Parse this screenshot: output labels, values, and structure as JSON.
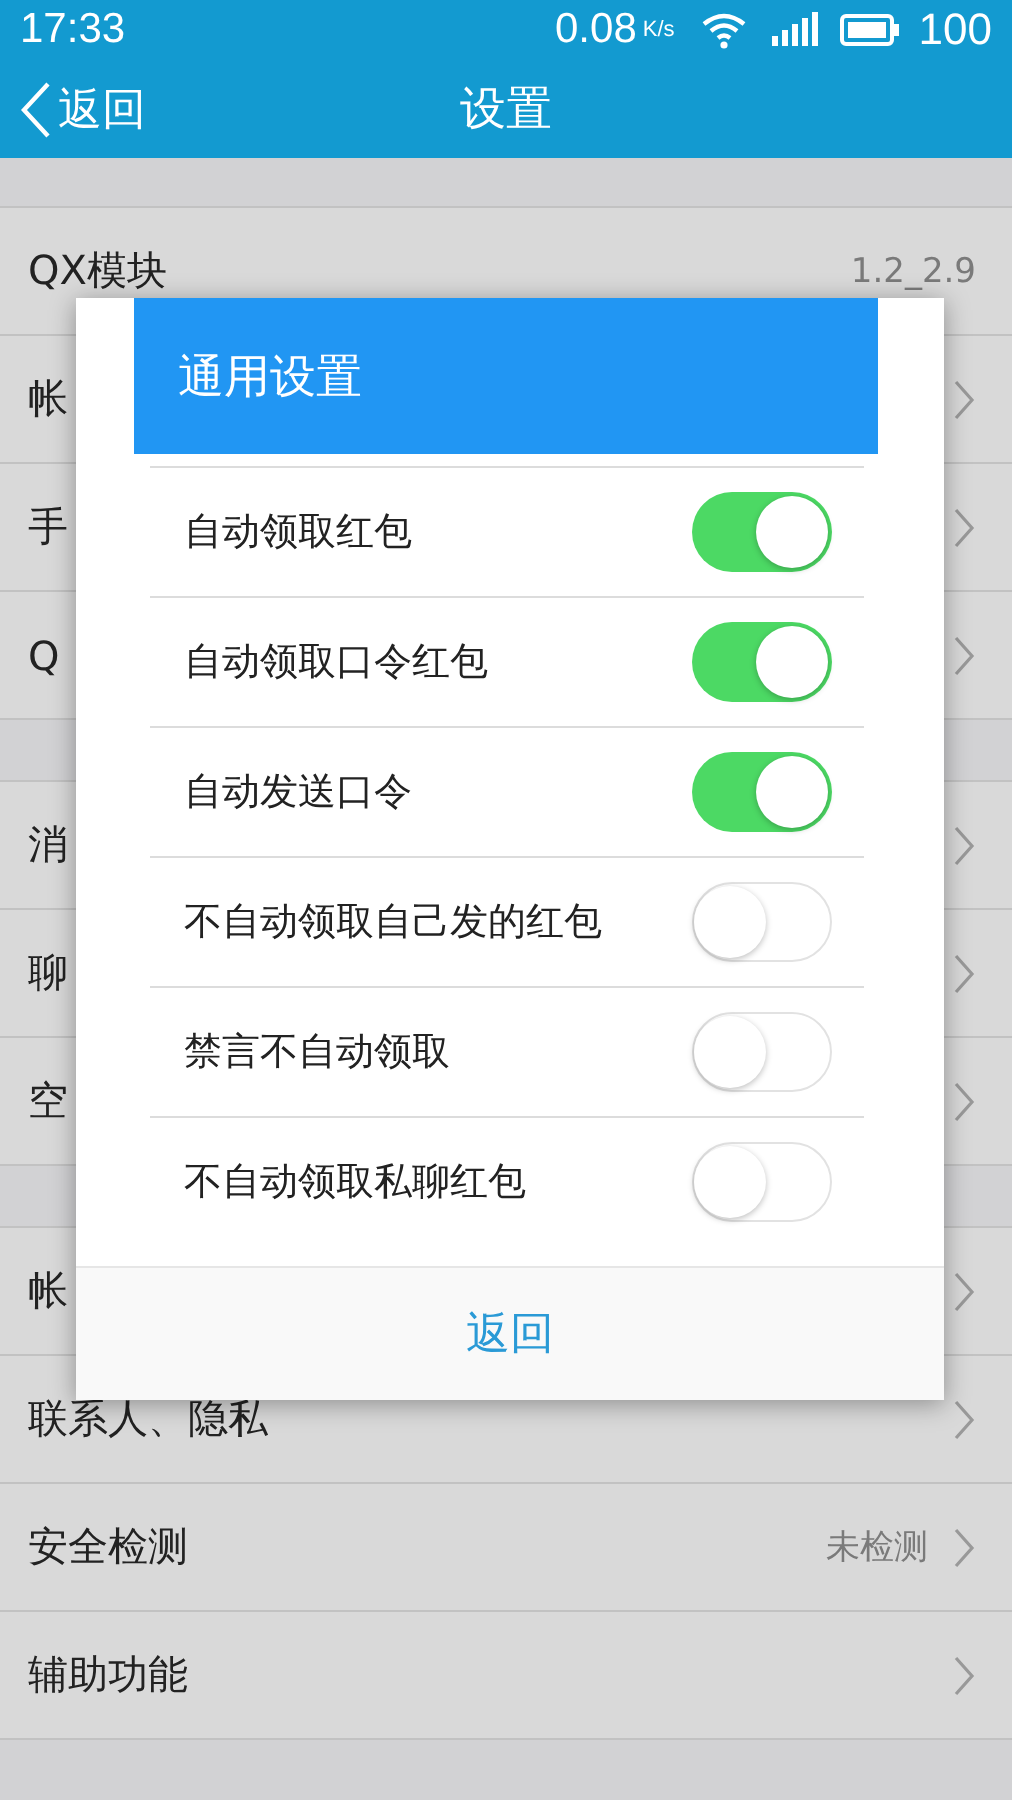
{
  "status_bar": {
    "time": "17:33",
    "speed": "0.08",
    "speed_unit": "K/s",
    "battery": "100"
  },
  "nav": {
    "back": "返回",
    "title": "设置"
  },
  "settings_groups": [
    {
      "rows": [
        {
          "label": "QX模块",
          "value": "1.2_2.9",
          "chevron": false
        },
        {
          "label": "帐",
          "chevron": true
        },
        {
          "label": "手",
          "chevron": true
        },
        {
          "label": "Q",
          "chevron": true
        }
      ]
    },
    {
      "rows": [
        {
          "label": "消",
          "chevron": true
        },
        {
          "label": "聊",
          "chevron": true
        },
        {
          "label": "空",
          "chevron": true
        }
      ]
    },
    {
      "rows": [
        {
          "label": "帐",
          "chevron": true
        },
        {
          "label": "联系人、隐私",
          "chevron": true
        },
        {
          "label": "安全检测",
          "value": "未检测",
          "chevron": true
        },
        {
          "label": "辅助功能",
          "chevron": true
        }
      ]
    }
  ],
  "dialog": {
    "title": "通用设置",
    "options": [
      {
        "label": "自动领取红包",
        "on": true
      },
      {
        "label": "自动领取口令红包",
        "on": true
      },
      {
        "label": "自动发送口令",
        "on": true
      },
      {
        "label": "不自动领取自己发的红包",
        "on": false
      },
      {
        "label": "禁言不自动领取",
        "on": false
      },
      {
        "label": "不自动领取私聊红包",
        "on": false
      }
    ],
    "button": "返回"
  }
}
